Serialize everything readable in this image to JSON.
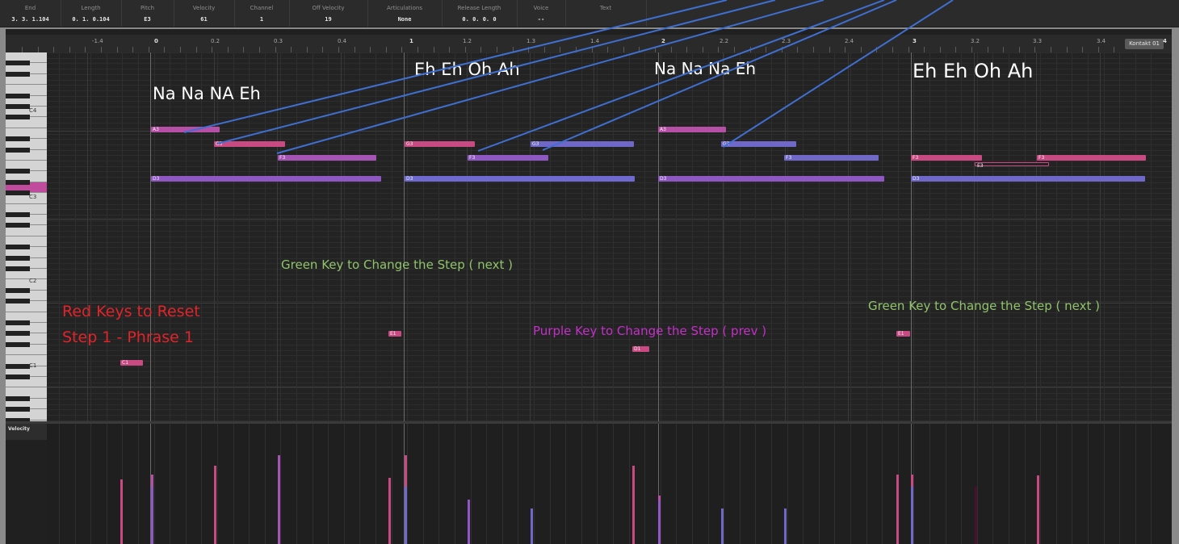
{
  "info_line": [
    {
      "label": "End",
      "value": "3. 3. 1.104"
    },
    {
      "label": "Length",
      "value": "0. 1. 0.104"
    },
    {
      "label": "Pitch",
      "value": "E3"
    },
    {
      "label": "Velocity",
      "value": "61"
    },
    {
      "label": "Channel",
      "value": "1"
    },
    {
      "label": "Off Velocity",
      "value": "19"
    },
    {
      "label": "Articulations",
      "value": "None"
    },
    {
      "label": "Release Length",
      "value": "0. 0. 0.   0"
    },
    {
      "label": "Voice",
      "value": "--"
    },
    {
      "label": "Text",
      "value": ""
    }
  ],
  "ruler": {
    "labels": [
      "-1.4",
      "0",
      "0.2",
      "0.3",
      "0.4",
      "1",
      "1.2",
      "1.3",
      "1.4",
      "2",
      "2.2",
      "2.3",
      "2.4",
      "3",
      "3.2",
      "3.3",
      "3.4"
    ],
    "bar_labels": [
      "0",
      "1",
      "2",
      "3"
    ],
    "end_marker": "4",
    "track_name": "Kontakt 01"
  },
  "keyboard": {
    "octave_labels": [
      "C4",
      "C3",
      "C2",
      "C1"
    ]
  },
  "notes": [
    {
      "pitch": "A3",
      "color": "#b64fa6"
    },
    {
      "pitch": "G3",
      "color": "#c94a82"
    },
    {
      "pitch": "F3",
      "color": "#a653b6"
    },
    {
      "pitch": "D3",
      "color": "#8e57c2"
    },
    {
      "pitch": "G3",
      "color": "#c94a82"
    },
    {
      "pitch": "F3",
      "color": "#8e57c2"
    },
    {
      "pitch": "G3",
      "color": "#6f68c9"
    },
    {
      "pitch": "D3",
      "color": "#6e6ad0"
    },
    {
      "pitch": "A3",
      "color": "#b64fa6"
    },
    {
      "pitch": "G3",
      "color": "#6f68c9"
    },
    {
      "pitch": "F3",
      "color": "#6f68c9"
    },
    {
      "pitch": "D3",
      "color": "#8e57c2"
    },
    {
      "pitch": "F3",
      "color": "#c94a82"
    },
    {
      "pitch": "E3",
      "color": "#222222"
    },
    {
      "pitch": "F3",
      "color": "#c94a82"
    },
    {
      "pitch": "D3",
      "color": "#6f68c9"
    },
    {
      "pitch": "C1",
      "color": "#c94a82"
    },
    {
      "pitch": "E1",
      "color": "#c94a82"
    },
    {
      "pitch": "D1",
      "color": "#c94a82"
    },
    {
      "pitch": "E1",
      "color": "#c94a82"
    }
  ],
  "velocity_lane": {
    "label": "Velocity"
  },
  "annotations": {
    "phrase1": "Na Na NA Eh",
    "phrase2": "Eh Eh Oh Ah",
    "phrase3": "Na Na Na Eh",
    "phrase4": "Eh Eh Oh Ah",
    "green_next_1": "Green Key to Change the Step ( next )",
    "green_next_2": "Green Key to Change the Step ( next )",
    "red_reset_line1": "Red Keys to Reset",
    "red_reset_line2": "Step 1 - Phrase 1",
    "purple_prev": "Purple Key to Change the Step ( prev )"
  },
  "colors": {
    "annotation_white": "#ffffff",
    "annotation_green": "#8fc46a",
    "annotation_red": "#e0242a",
    "annotation_purple": "#c42fc8",
    "callout_line": "#3f6fd1"
  }
}
